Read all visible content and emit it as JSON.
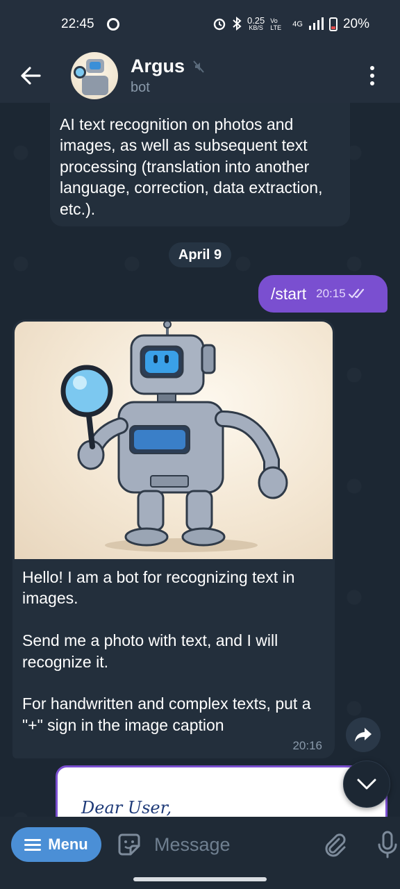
{
  "status_bar": {
    "time": "22:45",
    "net_speed": "0.25",
    "net_unit": "KB/S",
    "volte": "Vo LTE",
    "network": "4G",
    "battery": "20%"
  },
  "header": {
    "title": "Argus",
    "subtitle": "bot"
  },
  "messages": {
    "top_text": "AI text recognition on photos and images, as well as subsequent text processing (translation into another language, correction, data extraction, etc.).",
    "date_separator": "April 9",
    "outgoing": {
      "text": "/start",
      "time": "20:15"
    },
    "bot_reply": {
      "paragraphs": [
        "Hello! I am a bot for recognizing text in images.",
        "Send me a photo with text, and I will recognize it.",
        "For handwritten and complex texts, put a \"+\" sign in the image caption"
      ],
      "time": "20:16"
    },
    "handwriting_preview": "Dear User,"
  },
  "input_bar": {
    "menu_label": "Menu",
    "placeholder": "Message"
  },
  "colors": {
    "accent": "#7a4fd0",
    "menu_button": "#4b8fd6",
    "bubble_in": "#232f3c",
    "background": "#1c2733"
  },
  "icons": [
    "back-arrow-icon",
    "mute-icon",
    "more-vert-icon",
    "share-icon",
    "chevron-down-icon",
    "sticker-icon",
    "attach-icon",
    "mic-icon",
    "double-check-icon"
  ]
}
